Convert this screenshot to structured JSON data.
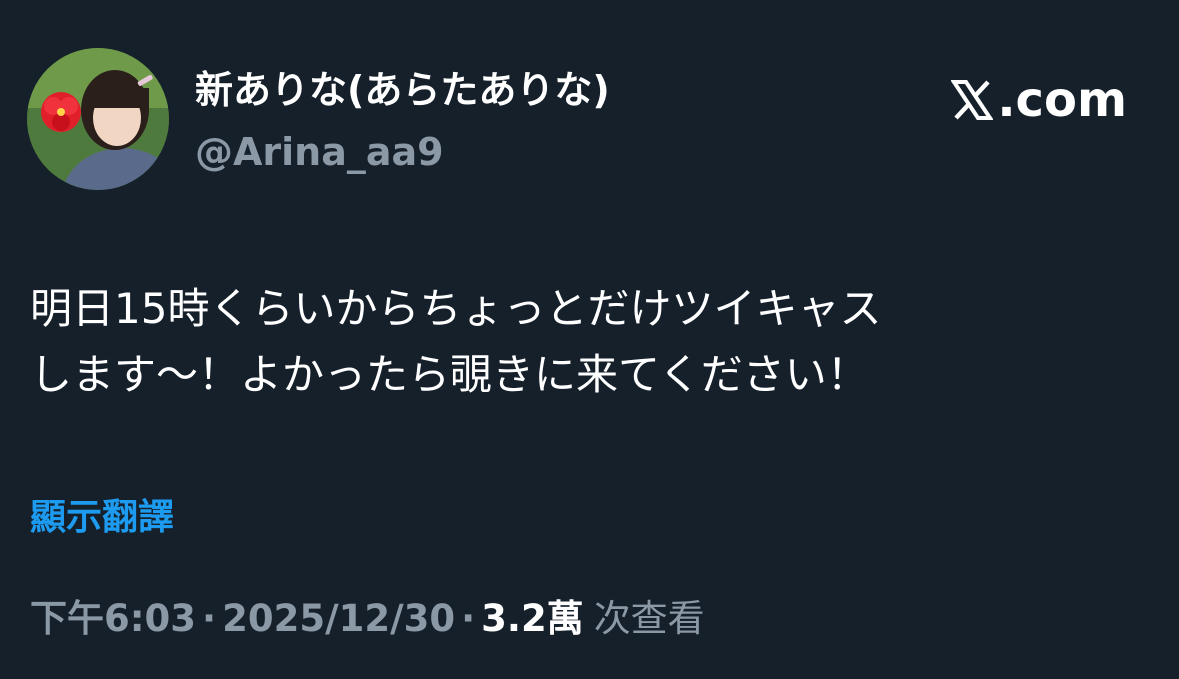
{
  "author": {
    "display_name": "新ありな(あらたありな)",
    "handle": "@Arina_aa9",
    "avatar_icon": "profile-photo-avatar"
  },
  "brand": {
    "icon": "x-logo-icon",
    "text": ".com"
  },
  "tweet": {
    "lines": [
      "明日15時くらいからちょっとだけツイキャス",
      "します～！よかったら覗きに来てください！"
    ]
  },
  "translate": {
    "label": "顯示翻譯"
  },
  "meta": {
    "time": "下午6:03",
    "separator": "·",
    "date": "2025/12/30",
    "view_count": "3.2萬",
    "views_label": "次查看"
  },
  "colors": {
    "background": "#15202b",
    "primary_text": "#ffffff",
    "secondary_text": "#8b98a5",
    "link": "#1d9bf0"
  }
}
